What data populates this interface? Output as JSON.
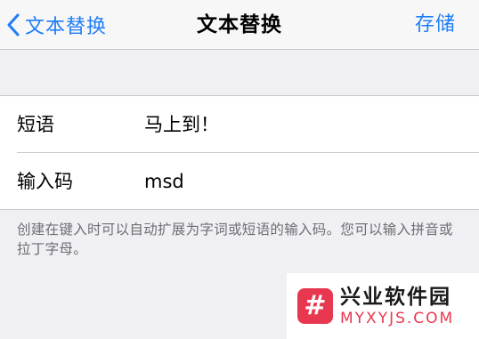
{
  "nav": {
    "back_label": "文本替换",
    "title": "文本替换",
    "save_label": "存储"
  },
  "form": {
    "phrase_label": "短语",
    "phrase_value": "马上到！",
    "shortcut_label": "输入码",
    "shortcut_value": "msd"
  },
  "footer_note": "创建在键入时可以自动扩展为字词或短语的输入码。您可以输入拼音或拉丁字母。",
  "watermark": {
    "logo_char": "#",
    "name": "兴业软件园",
    "domain": "MYXYJS.COM"
  },
  "colors": {
    "accent": "#1f7df7",
    "background": "#efeff4",
    "watermark_brand": "#e8384f"
  },
  "icons": {
    "back": "chevron-left-icon"
  }
}
